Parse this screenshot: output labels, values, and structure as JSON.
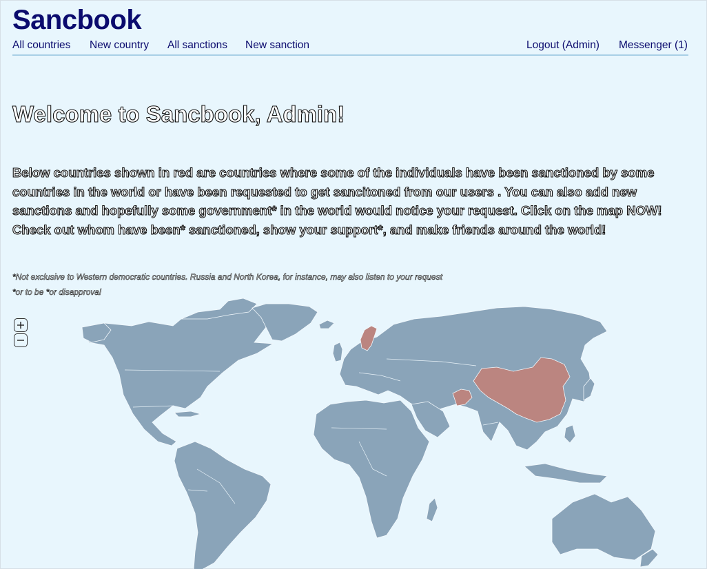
{
  "header": {
    "brand": "Sancbook",
    "nav_left": [
      "All countries",
      "New country",
      "All sanctions",
      "New sanction"
    ],
    "nav_right": [
      "Logout (Admin)",
      "Messenger (1)"
    ]
  },
  "main": {
    "welcome": "Welcome to Sancbook, Admin!",
    "intro": "Below countries shown in red are countries where some of the individuals have been sanctioned by some countries in the world or have been requested to get sancitoned from our users . You can also add new sanctions and hopefully some government* in the world would notice your request. Click on the map NOW! Check out whom have been* sanctioned, show your support*, and make friends around the world!",
    "footnote1": "*Not exclusive to Western democratic countries. Russia and North Korea, for instance, may also listen to your request",
    "footnote2": "*or to be   *or disapproval"
  },
  "map": {
    "zoom_in": "+",
    "zoom_out": "−",
    "colors": {
      "land": "#8aa4b9",
      "sanctioned": "#bb8580",
      "ocean": "#e8f6fd"
    },
    "sanctioned_countries": [
      "Sweden",
      "Afghanistan",
      "China"
    ]
  }
}
